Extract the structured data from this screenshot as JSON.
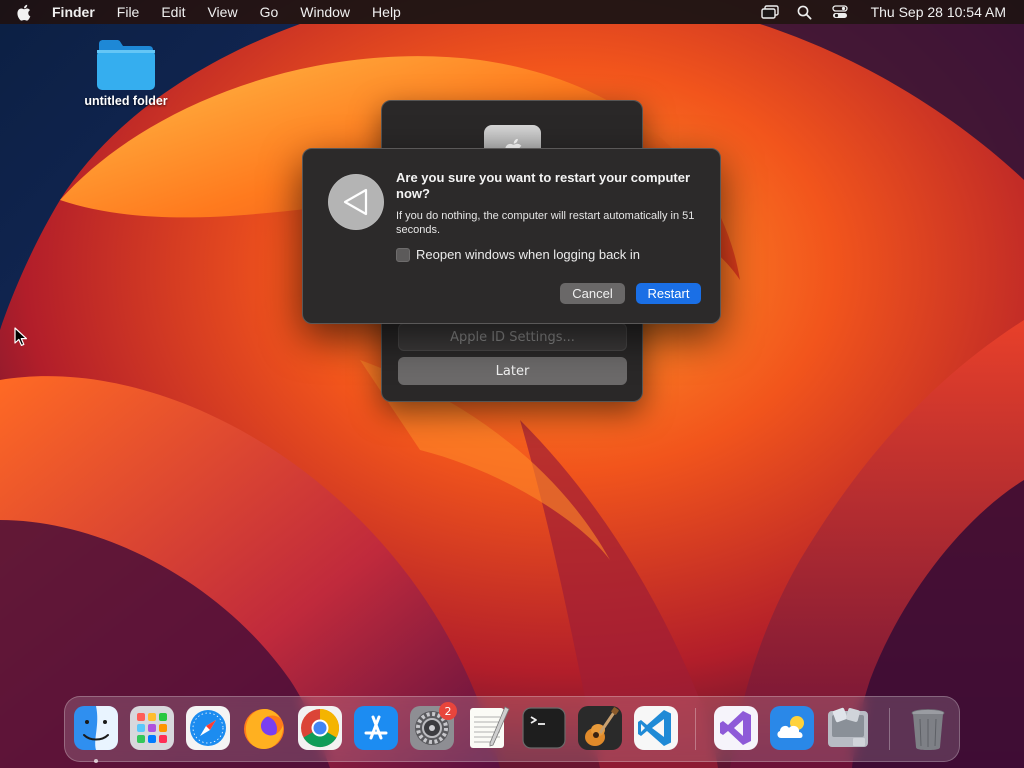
{
  "menubar": {
    "app_name": "Finder",
    "items": [
      "File",
      "Edit",
      "View",
      "Go",
      "Window",
      "Help"
    ],
    "clock": "Thu Sep 28  10:54 AM",
    "status_icons": [
      "screen-mirroring-icon",
      "spotlight-search-icon",
      "control-center-icon"
    ]
  },
  "desktop": {
    "folder_label": "untitled folder"
  },
  "update_panel": {
    "apple_id_button": "Apple ID Settings...",
    "later_button": "Later"
  },
  "dialog": {
    "title": "Are you sure you want to restart your computer now?",
    "message": "If you do nothing, the computer will restart automatically in 51 seconds.",
    "checkbox_label": "Reopen windows when logging back in",
    "checkbox_checked": false,
    "cancel_button": "Cancel",
    "restart_button": "Restart"
  },
  "dock": {
    "apps": [
      "finder-icon",
      "launchpad-icon",
      "safari-icon",
      "firefox-icon",
      "chrome-icon",
      "app-store-icon",
      "system-settings-icon",
      "textedit-icon",
      "terminal-icon",
      "garageband-icon",
      "vscode-icon",
      "visual-studio-icon",
      "weather-icon",
      "utility-icon",
      "trash-icon"
    ],
    "system_settings_badge": "2"
  },
  "colors": {
    "accent": "#1a6fe6",
    "badge": "#e8453c",
    "dialog_bg": "#2c2a2a"
  }
}
